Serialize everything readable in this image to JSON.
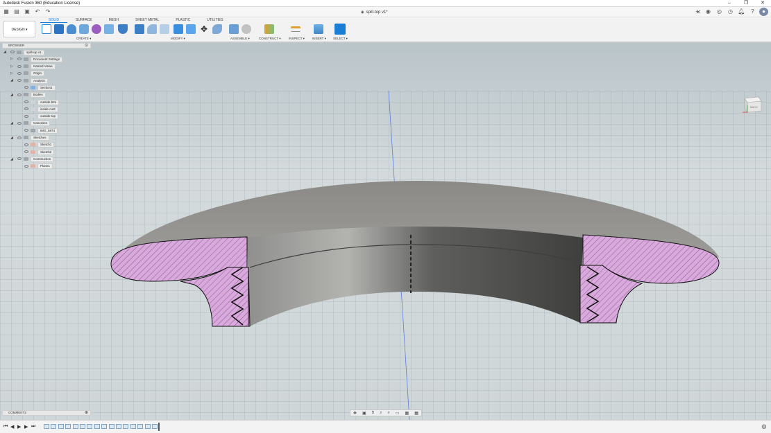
{
  "app": {
    "title": "Autodesk Fusion 360 (Education License)",
    "document_tab": "spill-top v1*"
  },
  "ribbon": {
    "workspace_button": "DESIGN ▾",
    "tabs": [
      {
        "label": "SOLID",
        "active": true
      },
      {
        "label": "SURFACE",
        "active": false
      },
      {
        "label": "MESH",
        "active": false
      },
      {
        "label": "SHEET METAL",
        "active": false
      },
      {
        "label": "PLASTIC",
        "active": false
      },
      {
        "label": "UTILITIES",
        "active": false
      }
    ],
    "groups": {
      "create": "CREATE ▾",
      "modify": "MODIFY ▾",
      "assemble": "ASSEMBLE ▾",
      "construct": "CONSTRUCT ▾",
      "inspect": "INSPECT ▾",
      "insert": "INSERT ▾",
      "select": "SELECT ▾"
    }
  },
  "browser": {
    "title": "BROWSER",
    "items": [
      {
        "label": "spill-top v1",
        "icon": "component-icon",
        "indent": 0
      },
      {
        "label": "Document Settings",
        "icon": "gear-icon",
        "indent": 1
      },
      {
        "label": "Named Views",
        "icon": "folder-icon",
        "indent": 1
      },
      {
        "label": "Origin",
        "icon": "folder-icon",
        "indent": 1
      },
      {
        "label": "Analysis",
        "icon": "folder-icon",
        "indent": 1
      },
      {
        "label": "Section1",
        "icon": "section-icon",
        "indent": 2
      },
      {
        "label": "Bodies",
        "icon": "folder-icon",
        "indent": 1
      },
      {
        "label": "outside btm",
        "icon": "body-icon",
        "indent": 2
      },
      {
        "label": "inside-cut2",
        "icon": "body-icon",
        "indent": 2
      },
      {
        "label": "outside top",
        "icon": "body-icon",
        "indent": 2
      },
      {
        "label": "Canvases",
        "icon": "folder-icon",
        "indent": 1
      },
      {
        "label": "IMG_5874",
        "icon": "canvas-icon",
        "indent": 2
      },
      {
        "label": "Sketches",
        "icon": "folder-icon",
        "indent": 1
      },
      {
        "label": "Sketch1",
        "icon": "sketch-icon",
        "indent": 2
      },
      {
        "label": "Sketch2",
        "icon": "sketch-icon",
        "indent": 2
      },
      {
        "label": "Construction",
        "icon": "folder-icon",
        "indent": 1
      },
      {
        "label": "Plane1",
        "icon": "plane-icon",
        "indent": 2
      }
    ]
  },
  "viewcube": {
    "face": "BACK"
  },
  "comments": {
    "title": "COMMENTS"
  },
  "colors": {
    "accent": "#1a7dd6",
    "section_hatch": "#d9a8dc",
    "body_gray": "#7d7d7b",
    "viewport_bg": "#cfd6d8"
  }
}
